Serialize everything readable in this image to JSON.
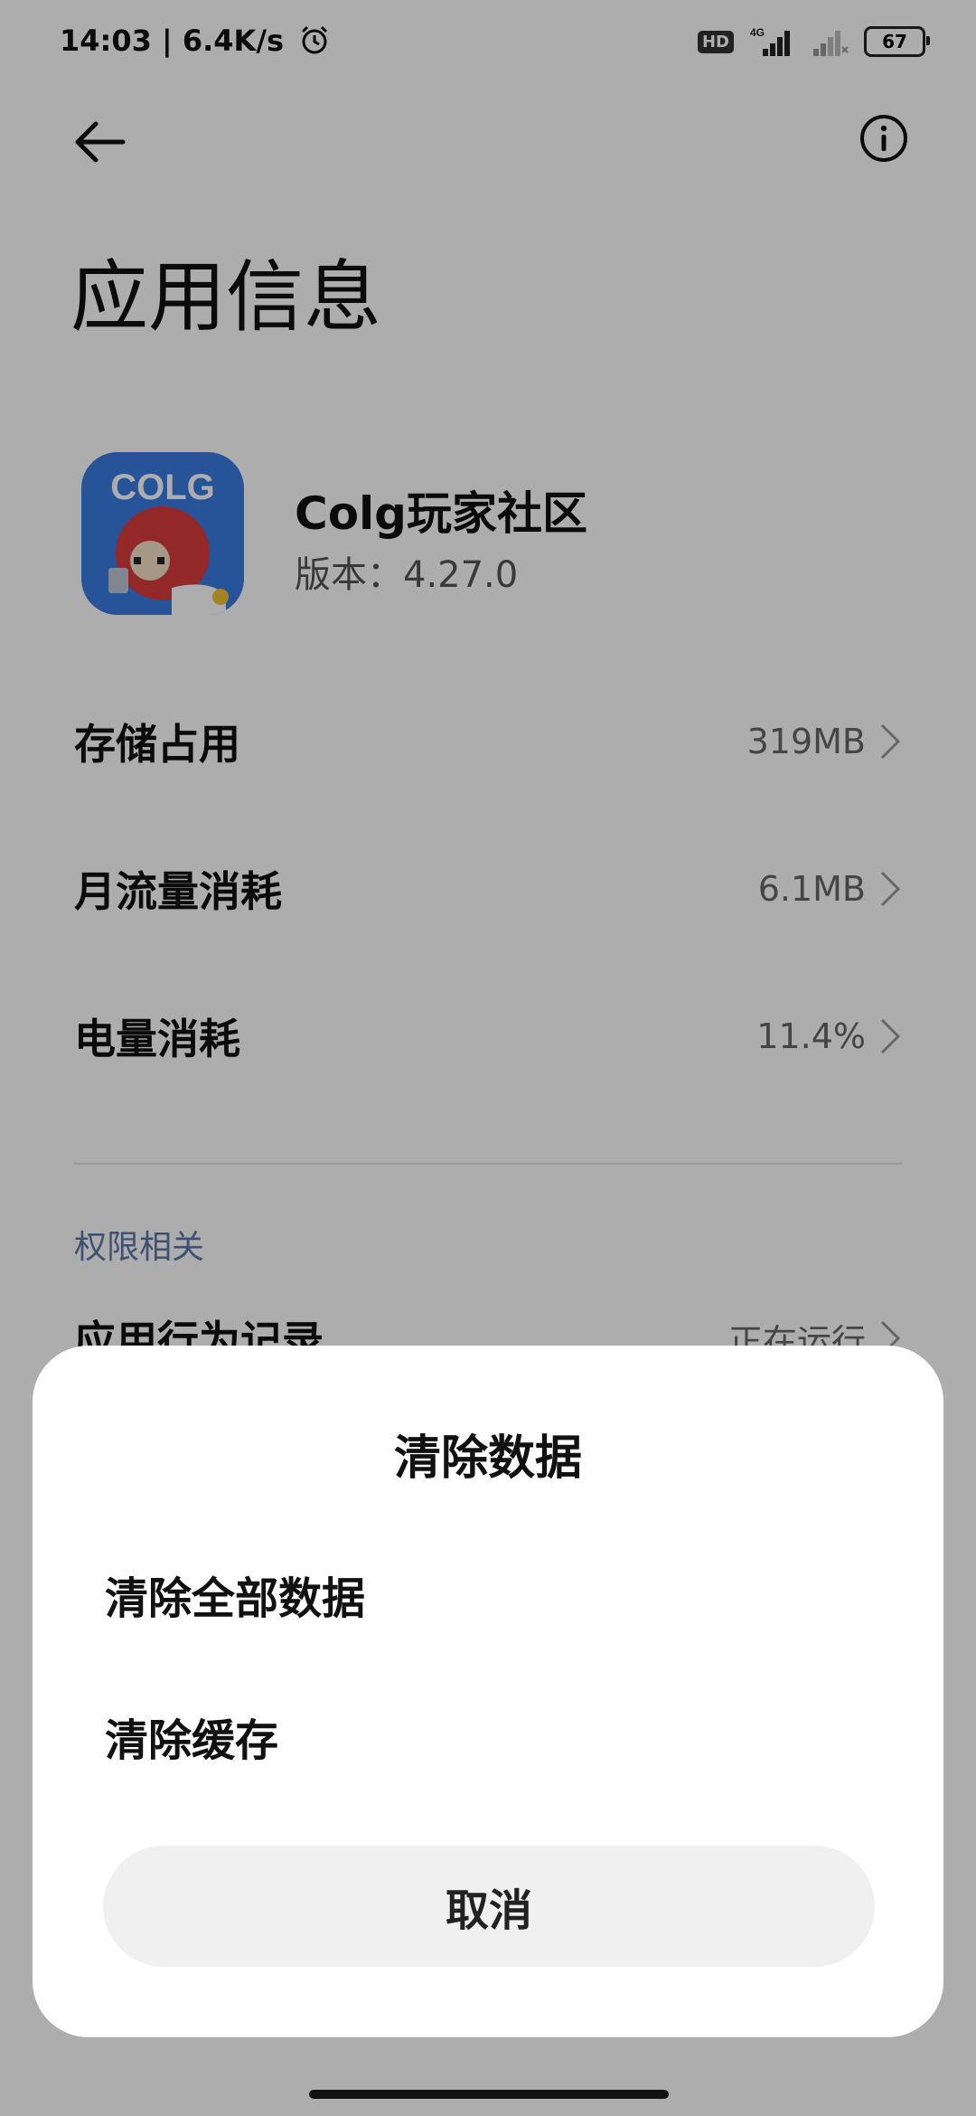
{
  "status_bar": {
    "time_speed": "14:03 | 6.4K/s",
    "network_label": "4G",
    "hd_label": "HD",
    "battery": "67"
  },
  "header": {
    "title": "应用信息"
  },
  "app": {
    "name": "Colg玩家社区",
    "version": "版本：4.27.0",
    "icon_text": "COLG"
  },
  "rows": [
    {
      "label": "存储占用",
      "value": "319MB"
    },
    {
      "label": "月流量消耗",
      "value": "6.1MB"
    },
    {
      "label": "电量消耗",
      "value": "11.4%"
    }
  ],
  "permissions": {
    "section_title": "权限相关",
    "partial_row": {
      "label": "应用行为记录",
      "value": "正在运行"
    }
  },
  "dialog": {
    "title": "清除数据",
    "options": [
      "清除全部数据",
      "清除缓存"
    ],
    "cancel": "取消"
  },
  "colors": {
    "section_blue": "#5d78a8",
    "cancel_bg": "#f0f0f0",
    "scrim": "rgba(0,0,0,0.32)"
  }
}
